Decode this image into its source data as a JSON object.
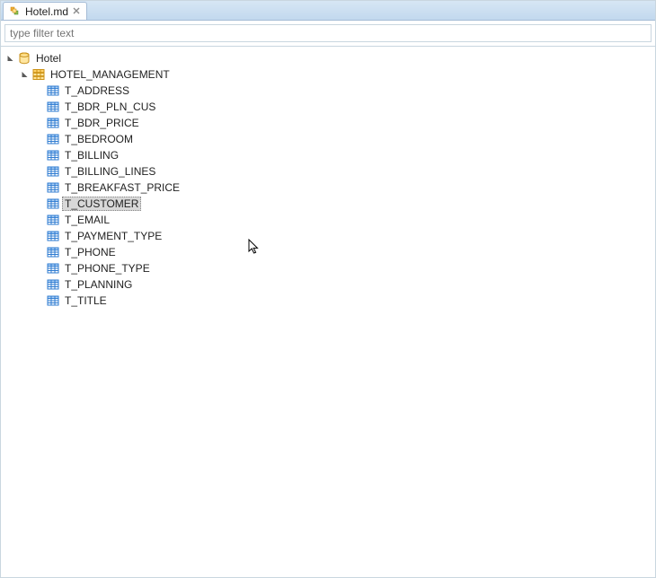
{
  "tab": {
    "label": "Hotel.md"
  },
  "filter": {
    "placeholder": "type filter text"
  },
  "tree": {
    "root": {
      "label": "Hotel",
      "icon": "database-icon",
      "expanded": true,
      "children": [
        {
          "label": "HOTEL_MANAGEMENT",
          "icon": "schema-icon",
          "expanded": true,
          "children": [
            {
              "label": "T_ADDRESS",
              "icon": "table-icon",
              "expanded": false
            },
            {
              "label": "T_BDR_PLN_CUS",
              "icon": "table-icon",
              "expanded": false
            },
            {
              "label": "T_BDR_PRICE",
              "icon": "table-icon",
              "expanded": false
            },
            {
              "label": "T_BEDROOM",
              "icon": "table-icon",
              "expanded": false
            },
            {
              "label": "T_BILLING",
              "icon": "table-icon",
              "expanded": false
            },
            {
              "label": "T_BILLING_LINES",
              "icon": "table-icon",
              "expanded": false
            },
            {
              "label": "T_BREAKFAST_PRICE",
              "icon": "table-icon",
              "expanded": false
            },
            {
              "label": "T_CUSTOMER",
              "icon": "table-icon",
              "expanded": false,
              "selected": true
            },
            {
              "label": "T_EMAIL",
              "icon": "table-icon",
              "expanded": false
            },
            {
              "label": "T_PAYMENT_TYPE",
              "icon": "table-icon",
              "expanded": false
            },
            {
              "label": "T_PHONE",
              "icon": "table-icon",
              "expanded": false
            },
            {
              "label": "T_PHONE_TYPE",
              "icon": "table-icon",
              "expanded": false
            },
            {
              "label": "T_PLANNING",
              "icon": "table-icon",
              "expanded": false
            },
            {
              "label": "T_TITLE",
              "icon": "table-icon",
              "expanded": false
            }
          ]
        }
      ]
    }
  }
}
